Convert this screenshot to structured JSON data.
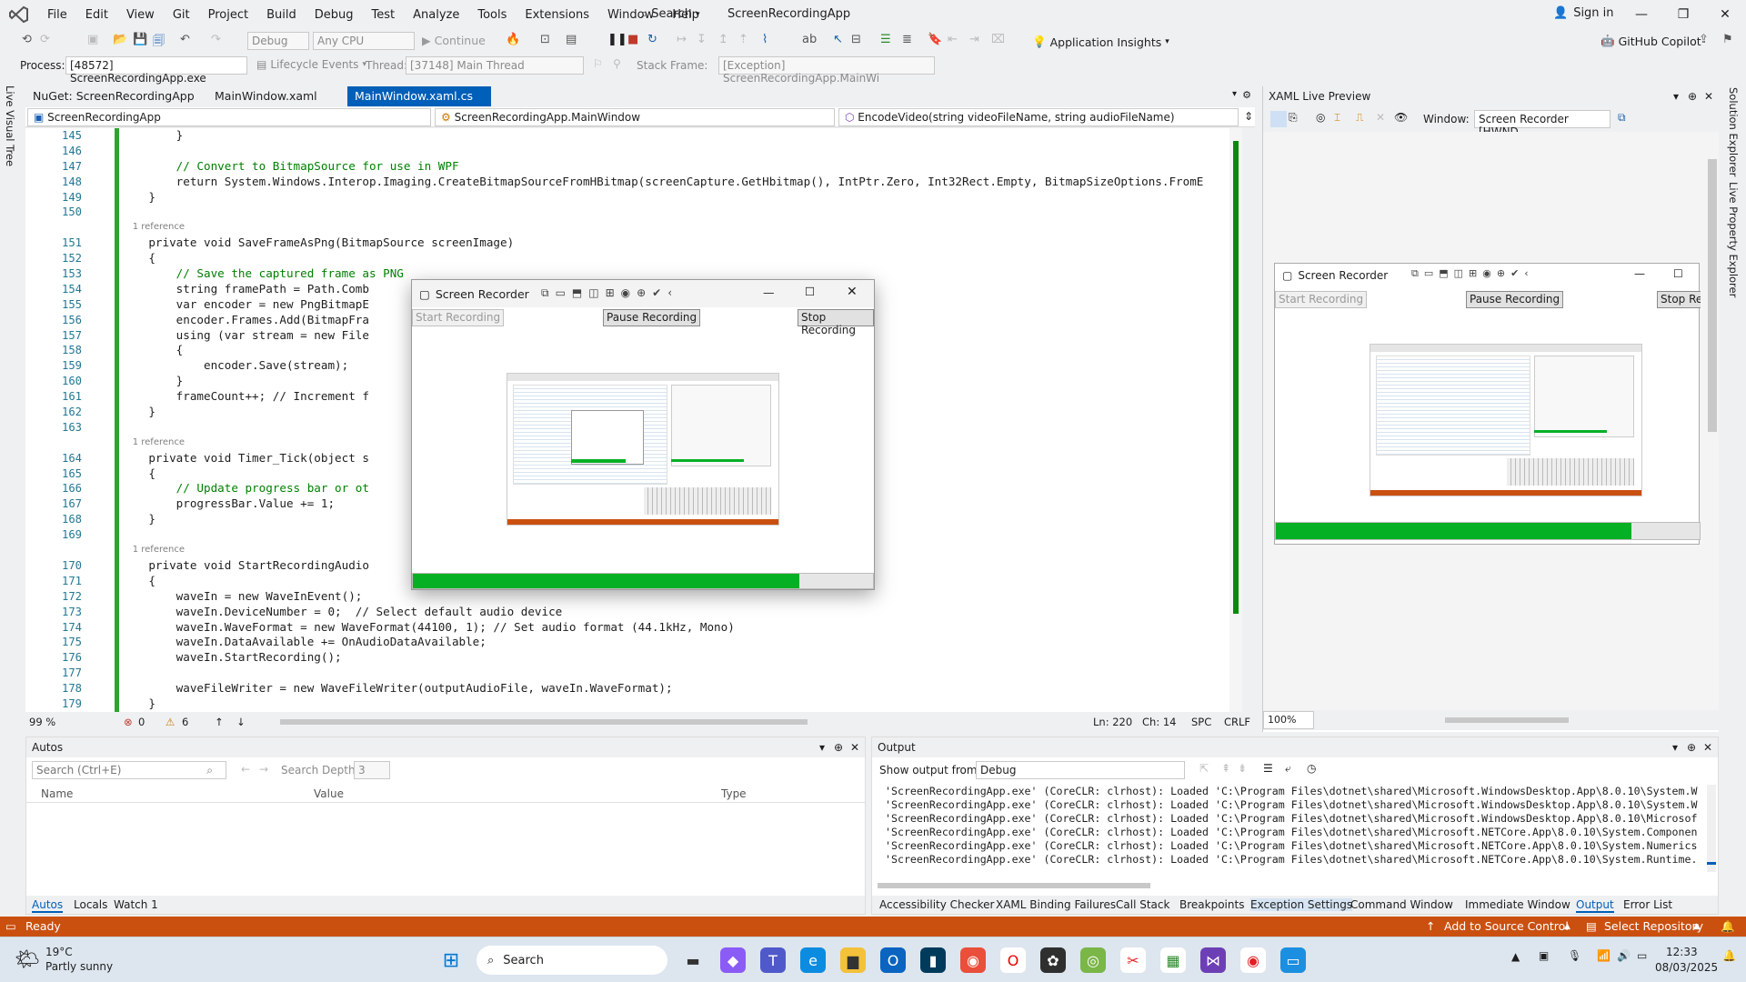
{
  "menu": {
    "items": [
      "File",
      "Edit",
      "View",
      "Git",
      "Project",
      "Build",
      "Debug",
      "Test",
      "Analyze",
      "Tools",
      "Extensions",
      "Window",
      "Help"
    ],
    "search_label": "Search",
    "app_title": "ScreenRecordingApp",
    "sign_in": "Sign in"
  },
  "toolbar": {
    "config": "Debug",
    "platform": "Any CPU",
    "continue_label": "Continue",
    "app_insights": "Application Insights",
    "copilot": "GitHub Copilot"
  },
  "debugbar": {
    "process_label": "Process:",
    "process_value": "[48572] ScreenRecordingApp.exe",
    "lifecycle": "Lifecycle Events",
    "thread_label": "Thread:",
    "thread_value": "[37148] Main Thread",
    "stackframe_label": "Stack Frame:",
    "stackframe_value": "[Exception] ScreenRecordingApp.MainWi"
  },
  "left_strip": "Live Visual Tree",
  "right_strip": [
    "Solution Explorer",
    "Live Property Explorer"
  ],
  "tabs": [
    {
      "label": "NuGet: ScreenRecordingApp"
    },
    {
      "label": "MainWindow.xaml"
    },
    {
      "label": "MainWindow.xaml.cs"
    }
  ],
  "navbar": {
    "project": "ScreenRecordingApp",
    "class": "ScreenRecordingApp.MainWindow",
    "member": "EncodeVideo(string videoFileName, string audioFileName)"
  },
  "code_lines": [
    {
      "n": "145",
      "t": "        }"
    },
    {
      "n": "146",
      "t": ""
    },
    {
      "n": "147",
      "t": "        // Convert to BitmapSource for use in WPF"
    },
    {
      "n": "148",
      "t": "        return System.Windows.Interop.Imaging.CreateBitmapSourceFromHBitmap(screenCapture.GetHbitmap(), IntPtr.Zero, Int32Rect.Empty, BitmapSizeOptions.FromE"
    },
    {
      "n": "149",
      "t": "    }"
    },
    {
      "n": "150",
      "t": ""
    },
    {
      "n": "",
      "t": "    1 reference"
    },
    {
      "n": "151",
      "t": "    private void SaveFrameAsPng(BitmapSource screenImage)"
    },
    {
      "n": "152",
      "t": "    {"
    },
    {
      "n": "153",
      "t": "        // Save the captured frame as PNG"
    },
    {
      "n": "154",
      "t": "        string framePath = Path.Comb"
    },
    {
      "n": "155",
      "t": "        var encoder = new PngBitmapE"
    },
    {
      "n": "156",
      "t": "        encoder.Frames.Add(BitmapFra"
    },
    {
      "n": "157",
      "t": "        using (var stream = new File"
    },
    {
      "n": "158",
      "t": "        {"
    },
    {
      "n": "159",
      "t": "            encoder.Save(stream);"
    },
    {
      "n": "160",
      "t": "        }"
    },
    {
      "n": "161",
      "t": "        frameCount++; // Increment f"
    },
    {
      "n": "162",
      "t": "    }"
    },
    {
      "n": "163",
      "t": ""
    },
    {
      "n": "",
      "t": "    1 reference"
    },
    {
      "n": "164",
      "t": "    private void Timer_Tick(object s"
    },
    {
      "n": "165",
      "t": "    {"
    },
    {
      "n": "166",
      "t": "        // Update progress bar or ot"
    },
    {
      "n": "167",
      "t": "        progressBar.Value += 1;"
    },
    {
      "n": "168",
      "t": "    }"
    },
    {
      "n": "169",
      "t": ""
    },
    {
      "n": "",
      "t": "    1 reference"
    },
    {
      "n": "170",
      "t": "    private void StartRecordingAudio"
    },
    {
      "n": "171",
      "t": "    {"
    },
    {
      "n": "172",
      "t": "        waveIn = new WaveInEvent();"
    },
    {
      "n": "173",
      "t": "        waveIn.DeviceNumber = 0;  // Select default audio device"
    },
    {
      "n": "174",
      "t": "        waveIn.WaveFormat = new WaveFormat(44100, 1); // Set audio format (44.1kHz, Mono)"
    },
    {
      "n": "175",
      "t": "        waveIn.DataAvailable += OnAudioDataAvailable;"
    },
    {
      "n": "176",
      "t": "        waveIn.StartRecording();"
    },
    {
      "n": "177",
      "t": ""
    },
    {
      "n": "178",
      "t": "        waveFileWriter = new WaveFileWriter(outputAudioFile, waveIn.WaveFormat);"
    },
    {
      "n": "179",
      "t": "    }"
    },
    {
      "n": "180",
      "t": ""
    }
  ],
  "editor_status": {
    "zoom": "99 %",
    "errors": "0",
    "warnings": "6",
    "ln": "Ln: 220",
    "ch": "Ch: 14",
    "spc": "SPC",
    "crlf": "CRLF"
  },
  "xaml_preview": {
    "title": "XAML Live Preview",
    "window_label": "Window:",
    "window_value": "Screen Recorder [HWND",
    "zoom": "100%"
  },
  "recorder": {
    "title": "Screen Recorder",
    "start": "Start Recording",
    "pause": "Pause Recording",
    "stop": "Stop Recording",
    "stop_short": "Stop Rec",
    "progress": 0.84
  },
  "autos": {
    "title": "Autos",
    "search_placeholder": "Search (Ctrl+E)",
    "search_depth_label": "Search Depth:",
    "search_depth": "3",
    "columns": [
      "Name",
      "Value",
      "Type"
    ],
    "tabs": [
      "Autos",
      "Locals",
      "Watch 1"
    ]
  },
  "output": {
    "title": "Output",
    "show_from_label": "Show output from:",
    "show_from_value": "Debug",
    "lines": [
      "'ScreenRecordingApp.exe' (CoreCLR: clrhost): Loaded 'C:\\Program Files\\dotnet\\shared\\Microsoft.WindowsDesktop.App\\8.0.10\\System.W",
      "'ScreenRecordingApp.exe' (CoreCLR: clrhost): Loaded 'C:\\Program Files\\dotnet\\shared\\Microsoft.WindowsDesktop.App\\8.0.10\\System.W",
      "'ScreenRecordingApp.exe' (CoreCLR: clrhost): Loaded 'C:\\Program Files\\dotnet\\shared\\Microsoft.WindowsDesktop.App\\8.0.10\\Microsof",
      "'ScreenRecordingApp.exe' (CoreCLR: clrhost): Loaded 'C:\\Program Files\\dotnet\\shared\\Microsoft.NETCore.App\\8.0.10\\System.Componen",
      "'ScreenRecordingApp.exe' (CoreCLR: clrhost): Loaded 'C:\\Program Files\\dotnet\\shared\\Microsoft.NETCore.App\\8.0.10\\System.Numerics",
      "'ScreenRecordingApp.exe' (CoreCLR: clrhost): Loaded 'C:\\Program Files\\dotnet\\shared\\Microsoft.NETCore.App\\8.0.10\\System.Runtime."
    ],
    "tabs": [
      "Accessibility Checker",
      "XAML Binding Failures",
      "Call Stack",
      "Breakpoints",
      "Exception Settings",
      "Command Window",
      "Immediate Window",
      "Output",
      "Error List"
    ]
  },
  "statusbar": {
    "ready": "Ready",
    "source_control": "Add to Source Control",
    "repository": "Select Repository"
  },
  "taskbar": {
    "temp": "19°C",
    "weather": "Partly sunny",
    "search": "Search",
    "time": "12:33",
    "date": "08/03/2025"
  },
  "colors": {
    "accent": "#005fb8",
    "status": "#ca5010",
    "progress": "#06b025"
  }
}
